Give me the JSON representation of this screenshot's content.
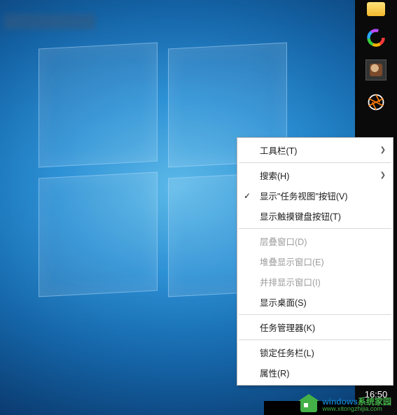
{
  "context_menu": {
    "items": [
      {
        "label": "工具栏(T)",
        "has_submenu": true,
        "enabled": true,
        "checked": false
      },
      {
        "type": "sep"
      },
      {
        "label": "搜索(H)",
        "has_submenu": true,
        "enabled": true,
        "checked": false
      },
      {
        "label": "显示\"任务视图\"按钮(V)",
        "has_submenu": false,
        "enabled": true,
        "checked": true
      },
      {
        "label": "显示触摸键盘按钮(T)",
        "has_submenu": false,
        "enabled": true,
        "checked": false
      },
      {
        "type": "sep"
      },
      {
        "label": "层叠窗口(D)",
        "has_submenu": false,
        "enabled": false,
        "checked": false
      },
      {
        "label": "堆叠显示窗口(E)",
        "has_submenu": false,
        "enabled": false,
        "checked": false
      },
      {
        "label": "并排显示窗口(I)",
        "has_submenu": false,
        "enabled": false,
        "checked": false
      },
      {
        "label": "显示桌面(S)",
        "has_submenu": false,
        "enabled": true,
        "checked": false
      },
      {
        "type": "sep"
      },
      {
        "label": "任务管理器(K)",
        "has_submenu": false,
        "enabled": true,
        "checked": false
      },
      {
        "type": "sep"
      },
      {
        "label": "锁定任务栏(L)",
        "has_submenu": false,
        "enabled": true,
        "checked": false
      },
      {
        "label": "属性(R)",
        "has_submenu": false,
        "enabled": true,
        "checked": false
      }
    ],
    "highlighted_index": 12
  },
  "clock": {
    "time": "16:50"
  },
  "watermark": {
    "brand_main": "windows",
    "brand_sub": "系统家园",
    "url": "www.xitongzhijia.com"
  }
}
